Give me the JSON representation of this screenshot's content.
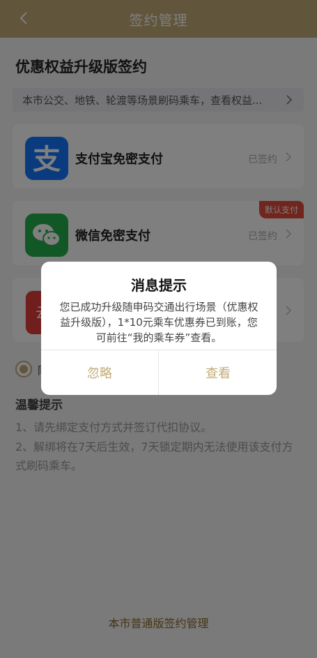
{
  "header": {
    "title": "签约管理",
    "back_icon": "back-chevron-icon"
  },
  "section": {
    "title": "优惠权益升级版签约"
  },
  "banner": {
    "text": "本市公交、地铁、轮渡等场景刷码乘车，查看权益..."
  },
  "payments": [
    {
      "name": "支付宝免密支付",
      "status": "已签约",
      "logo_icon": "alipay-icon",
      "color": "#1677ff"
    },
    {
      "name": "微信免密支付",
      "status": "已签约",
      "logo_icon": "wechat-icon",
      "color": "#23b14d",
      "badge": "默认支付"
    },
    {
      "name": "",
      "status": "",
      "logo_icon": "unionpay-cloud-icon",
      "logo_text": "云"
    }
  ],
  "agreement": {
    "label": "同"
  },
  "tips": {
    "title": "温馨提示",
    "items": [
      "1、请先绑定支付方式并签订代扣协议。",
      "2、解绑将在7天后生效，7天锁定期内无法使用该支付方式刷码乘车。"
    ]
  },
  "footer": {
    "link": "本市普通版签约管理"
  },
  "dialog": {
    "title": "消息提示",
    "body": "您已成功升级随申码交通出行场景（优惠权益升级版），1*10元乘车优惠券已到账，您可前往“我的乘车券”查看。",
    "ignore_label": "忽略",
    "view_label": "查看"
  },
  "colors": {
    "accent": "#c3ab78",
    "badge": "#e04a3a"
  }
}
